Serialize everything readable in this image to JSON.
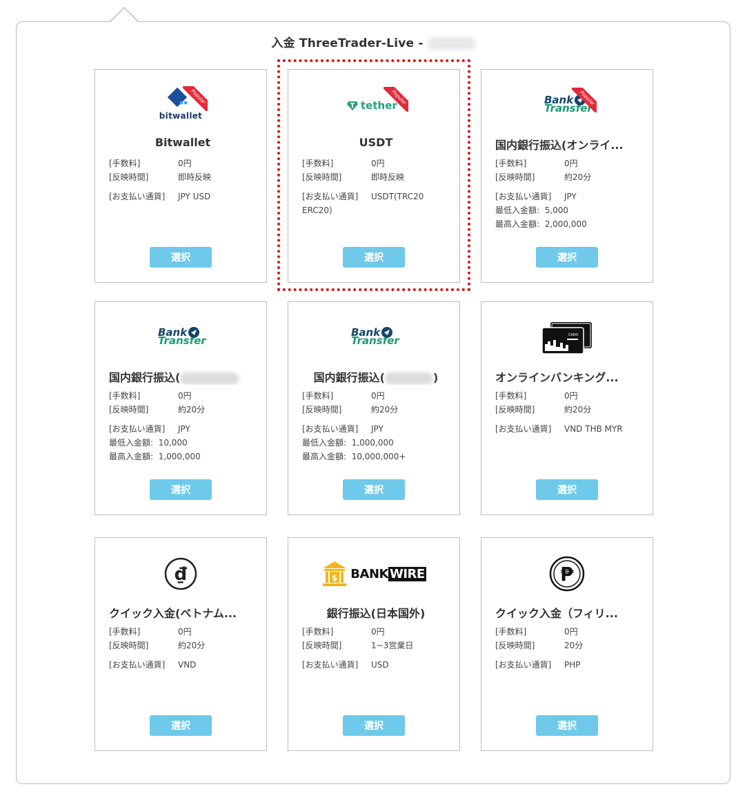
{
  "header": {
    "title": "入金 ThreeTrader-Live -"
  },
  "labels": {
    "fee": "[手数料]",
    "time": "[反映時間]",
    "currency": "[お支払い通貨]",
    "min": "最低入金額:",
    "max": "最高入金額:",
    "select": "選択",
    "popular": "Popular"
  },
  "cards": [
    {
      "name": "Bitwallet",
      "logo_text": "bitwallet",
      "icon": "bitwallet-icon",
      "fee": "0円",
      "time": "即時反映",
      "currency": "JPY USD"
    },
    {
      "name": "USDT",
      "logo_text": "tether",
      "icon": "tether-icon",
      "fee": "0円",
      "time": "即時反映",
      "currency": "USDT(TRC20 ERC20)"
    },
    {
      "name": "国内銀行振込(オンライ...",
      "logo_text_1": "Bank",
      "logo_text_2": "Transfer",
      "icon": "bank-transfer-icon",
      "fee": "0円",
      "time": "約20分",
      "currency": "JPY",
      "min": "5,000",
      "max": "2,000,000"
    },
    {
      "name": "国内銀行振込(",
      "logo_text_1": "Bank",
      "logo_text_2": "Transfer",
      "icon": "bank-transfer-icon",
      "fee": "0円",
      "time": "約20分",
      "currency": "JPY",
      "min": "10,000",
      "max": "1,000,000"
    },
    {
      "name_prefix": "国内銀行振込(",
      "name_suffix": ")",
      "logo_text_1": "Bank",
      "logo_text_2": "Transfer",
      "icon": "bank-transfer-icon",
      "fee": "0円",
      "time": "約20分",
      "currency": "JPY",
      "min": "1,000,000",
      "max": "10,000,000+"
    },
    {
      "name": "オンラインバンキング...",
      "logo_text": "CARD",
      "icon": "card-icon",
      "fee": "0円",
      "time": "約20分",
      "currency": "VND THB MYR"
    },
    {
      "name": "クイック入金(ベトナム...",
      "icon": "dong-icon",
      "fee": "0円",
      "time": "約20分",
      "currency": "VND"
    },
    {
      "name": "銀行振込(日本国外)",
      "logo_text_1": "BANK",
      "logo_text_2": "WIRE",
      "icon": "bank-wire-icon",
      "fee": "0円",
      "time": "1~3営業日",
      "currency": "USD"
    },
    {
      "name": "クイック入金（フィリ...",
      "icon": "peso-icon",
      "fee": "0円",
      "time": "20分",
      "currency": "PHP"
    }
  ]
}
